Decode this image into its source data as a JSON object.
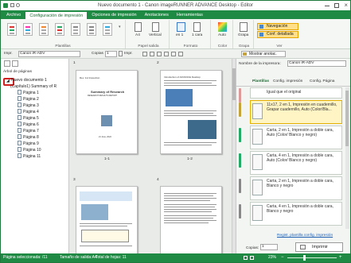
{
  "window": {
    "title": "Nuevo documento 1 - Canon imageRUNNER ADVANCE Desktop - Editor",
    "controls": [
      "minimize-icon",
      "maximize-icon",
      "close-icon"
    ]
  },
  "tabs": [
    {
      "label": "Archivo"
    },
    {
      "label": "Configuración de impresión"
    },
    {
      "label": "Opciones de impresión"
    },
    {
      "label": "Anotaciones"
    },
    {
      "label": "Herramientas"
    }
  ],
  "ribbon": {
    "groups": {
      "plantillas": "Plantillas",
      "papel_salida": "Papel salida",
      "formato": "Formato",
      "color": "Color",
      "grapa": "Grapa",
      "ver": "Ver"
    },
    "a4": "A4",
    "vertical": "Vertical",
    "en": "en 1",
    "cara": "1 cara",
    "auto": "Auto",
    "grapa_btn": "Grapa",
    "navegacion": "Navegación",
    "conf_detallada": "Conf. detallada"
  },
  "toolbar": {
    "impr_label": "Impr.",
    "printer": "Canon iR-ADV",
    "copias_label": "Copias",
    "copias_value": "1",
    "impr_btn": "Impr.",
    "mostrar_anotac": "Mostrar anotac."
  },
  "tree": {
    "header": "Árbol de páginas",
    "root": "Nuevo documento 1",
    "chapter": "(Capítulo1) Summary of R",
    "pages": [
      "Página 1",
      "Página 2",
      "Página 3",
      "Página 4",
      "Página 5",
      "Página 6",
      "Página 7",
      "Página 8",
      "Página 9",
      "Página 10",
      "Página 11"
    ]
  },
  "center": {
    "page1_no": "1",
    "page2_no": "2",
    "page3_no": "3",
    "page4_no": "4",
    "caption1": "1-1",
    "caption2": "1-2",
    "page1_header": "Rev. 1st Inspection",
    "page1_title": "Summary of Research",
    "page1_sub": "RESEARCH RESULTS REPORT",
    "page1_date": "21 June, 2022",
    "page2_title": "Introduction of ADVANCE Desktop"
  },
  "right": {
    "printer_label": "Nombre de la impresora:",
    "printer_value": "Canon iR-ADV",
    "subtabs": [
      "Plantillas",
      "Config. impresión",
      "Config. Página"
    ],
    "templates": [
      "Igual que el original",
      "11x17, 2 en 1, Impresión en cuadernillo, Grapar cuadernillo, Auto (Color/Bla...",
      "Carta, 2 en 1, Impresión a doble cara, Auto (Color/ Blanco y negro)",
      "Carta, 4 en 1, Impresión a doble cara, Auto (Color/ Blanco y negro)",
      "Carta, 2 en 1, Impresión a doble cara, Blanco y negro",
      "Carta, 4 en 1, Impresión a doble cara, Blanco y negro"
    ],
    "reg_link": "Regist. plantilla config. impresión",
    "copias_label": "Copias:",
    "copias_value": "1",
    "imprimir": "Imprimir"
  },
  "status": {
    "page_selected": "Página seleccionada: /11",
    "output_size": "Tamaño de salida:A4",
    "total_sheets": "Total de hojas: 11",
    "zoom": "23%"
  },
  "colors": {
    "accent": "#1e8a44",
    "highlight": "#d21f1f",
    "selected": "#ffd35c"
  }
}
